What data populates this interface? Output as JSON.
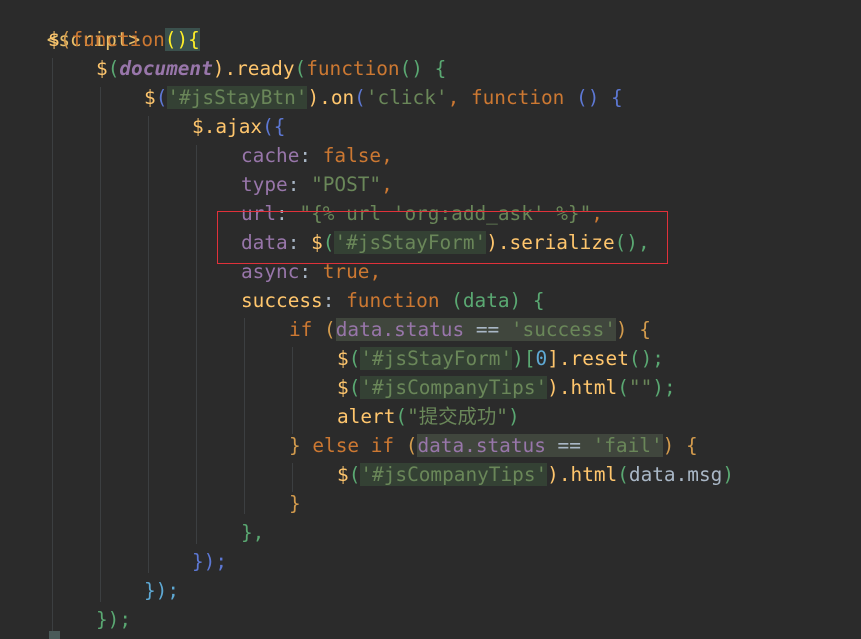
{
  "code": {
    "l1_tag": "<script>",
    "l2_dollar": "$",
    "l2_paren": "(",
    "l2_function": "function",
    "l2_open": "(){",
    "l3_dollar": "$",
    "l3_paren": "(",
    "l3_document": "document",
    "l3_ready": ").ready",
    "l3_paren2": "(",
    "l3_function": "function",
    "l3_tail": "() {",
    "l4_dollar": "$",
    "l4_paren": "(",
    "l4_sel": "'#jsStayBtn'",
    "l4_on": ").on",
    "l4_paren2": "(",
    "l4_click": "'click'",
    "l4_comma": ", ",
    "l4_function": "function",
    "l4_tail": " () {",
    "l5_dollar": "$",
    "l5_ajax": ".ajax",
    "l5_open": "({",
    "l6_key": "cache",
    "l6_colon": ": ",
    "l6_val": "false",
    "l6_comma": ",",
    "l7_key": "type",
    "l7_colon": ": ",
    "l7_val": "\"POST\"",
    "l7_comma": ",",
    "l8_key": "url",
    "l8_colon": ": ",
    "l8_val": "\"{% url 'org:add_ask' %}\"",
    "l8_comma": ",",
    "l9_key": "data",
    "l9_colon": ": ",
    "l9_dollar": "$",
    "l9_paren": "(",
    "l9_sel": "'#jsStayForm'",
    "l9_serialize": ").serialize",
    "l9_tail": "(),",
    "l10_key": "async",
    "l10_colon": ": ",
    "l10_val": "true",
    "l10_comma": ",",
    "l11_key": "success",
    "l11_colon": ": ",
    "l11_function": "function",
    "l11_args": " (data) {",
    "l12_if": "if",
    "l12_paren": " (",
    "l12_cond": "data.status",
    "l12_op": " == ",
    "l12_val": "'success'",
    "l12_tail": ") {",
    "l13_dollar": "$",
    "l13_paren": "(",
    "l13_sel": "'#jsStayForm'",
    "l13_index": ")[",
    "l13_zero": "0",
    "l13_reset": "].reset",
    "l13_tail": "();",
    "l14_dollar": "$",
    "l14_paren": "(",
    "l14_sel": "'#jsCompanyTips'",
    "l14_html": ").html",
    "l14_paren2": "(",
    "l14_str": "\"\"",
    "l14_tail": ");",
    "l15_alert": "alert",
    "l15_paren": "(",
    "l15_str": "\"提交成功\"",
    "l15_tail": ")",
    "l16_close": "} ",
    "l16_else": "else if",
    "l16_paren": " (",
    "l16_cond": "data.status",
    "l16_op": " == ",
    "l16_val": "'fail'",
    "l16_tail": ") {",
    "l17_dollar": "$",
    "l17_paren": "(",
    "l17_sel": "'#jsCompanyTips'",
    "l17_html": ").html",
    "l17_paren2": "(",
    "l17_arg": "data.msg",
    "l17_tail": ")",
    "l18_close": "}",
    "l19_close": "},",
    "l20_close": "});",
    "l21_close": "});",
    "l22_close": "});"
  }
}
